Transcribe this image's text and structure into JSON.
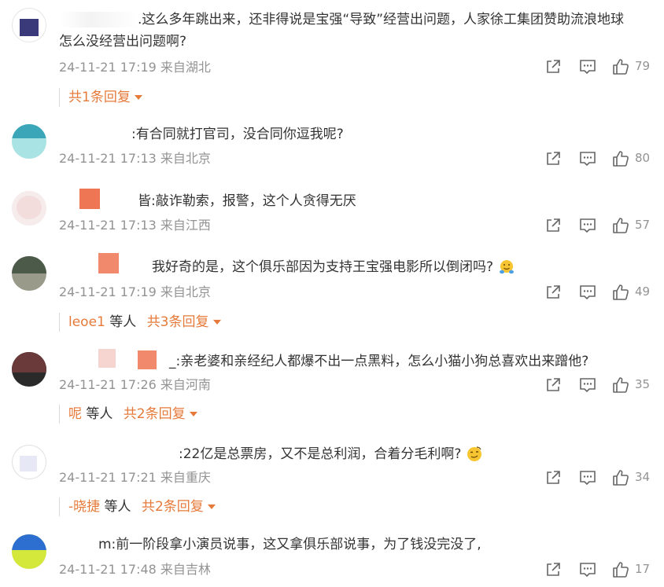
{
  "comments": [
    {
      "text_line1": ".这么多年跳出来，还非得说是宝强“导致”经营出问题，人家徐工集团赞助流浪地球",
      "text_line2": "怎么没经营出问题啊?",
      "meta": "24-11-21 17:19 来自湖北",
      "likes": "79",
      "replies": {
        "users": "",
        "label": "共1条回复"
      }
    },
    {
      "text_line1": ":有合同就打官司，没合同你逗我呢?",
      "meta": "24-11-21 17:13 来自北京",
      "likes": "80"
    },
    {
      "text_line1": "皆:敲诈勒索，报警，这个人贪得无厌",
      "meta": "24-11-21 17:13 来自江西",
      "likes": "57"
    },
    {
      "text_line1": "我好奇的是，这个俱乐部因为支持王宝强电影所以倒闭吗?",
      "meta": "24-11-21 17:19 来自北京",
      "likes": "49",
      "replies": {
        "user_a": "leo",
        "user_b": "e1",
        "others": "等人",
        "label": "共3条回复"
      }
    },
    {
      "text_line1": "_:亲老婆和亲经纪人都爆不出一点黑料，怎么小猫小狗总喜欢出来蹭他?",
      "meta": "24-11-21 17:26 来自河南",
      "likes": "35",
      "replies": {
        "user_a": "",
        "user_b": "呢",
        "others": "等人",
        "label": "共2条回复"
      }
    },
    {
      "text_line1": ":22亿是总票房，又不是总利润，合着分毛利啊?",
      "meta": "24-11-21 17:21 来自重庆",
      "likes": "34",
      "replies": {
        "user_a": "-晓捷",
        "user_b": "",
        "others": "等人",
        "label": "共2条回复"
      }
    },
    {
      "text_line1": "m:前一阶段拿小演员说事，这又拿俱乐部说事，为了钱没完没了,",
      "meta": "24-11-21 17:48 来自吉林",
      "likes": "17"
    }
  ],
  "icons": {
    "share": "share-icon",
    "comment": "comment-icon",
    "like": "like-icon"
  },
  "colors": {
    "accent": "#e57a3a",
    "meta": "#939393",
    "text": "#333333"
  }
}
